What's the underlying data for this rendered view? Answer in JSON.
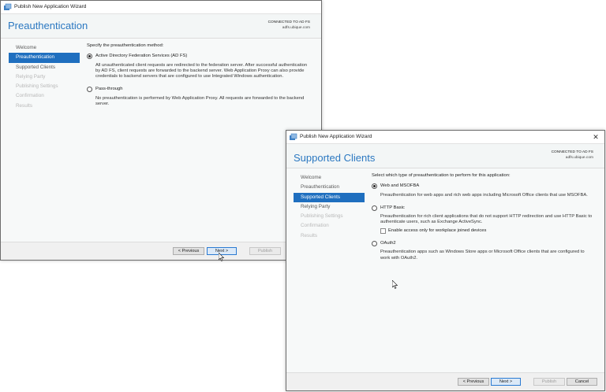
{
  "window1": {
    "title": "Publish New Application Wizard",
    "close_glyph": "✕",
    "icon": "wizard-app-icon",
    "page_title": "Preauthentication",
    "connection_label": "CONNECTED TO AD FS",
    "connection_server": "adfs.ubique.com",
    "nav": [
      {
        "label": "Welcome",
        "state": "normal"
      },
      {
        "label": "Preauthentication",
        "state": "active"
      },
      {
        "label": "Supported Clients",
        "state": "normal"
      },
      {
        "label": "Relying Party",
        "state": "disabled"
      },
      {
        "label": "Publishing Settings",
        "state": "disabled"
      },
      {
        "label": "Confirmation",
        "state": "disabled"
      },
      {
        "label": "Results",
        "state": "disabled"
      }
    ],
    "prompt": "Specify the preauthentication method:",
    "options": [
      {
        "label": "Active Directory Federation Services (AD FS)",
        "selected": true,
        "description": "All unauthenticated client requests are redirected to the federation server. After successful authentication by AD FS, client requests are forwarded to the backend server. Web Application Proxy can also provide credentials to backend servers that are configured to use Integrated Windows authentication."
      },
      {
        "label": "Pass-through",
        "selected": false,
        "description": "No preauthentication is performed by Web Application Proxy. All requests are forwarded to the backend server."
      }
    ],
    "buttons": {
      "previous": "< Previous",
      "next": "Next >",
      "publish": "Publish"
    }
  },
  "window2": {
    "title": "Publish New Application Wizard",
    "close_glyph": "✕",
    "icon": "wizard-app-icon",
    "page_title": "Supported Clients",
    "connection_label": "CONNECTED TO AD FS",
    "connection_server": "adfs.ubique.com",
    "nav": [
      {
        "label": "Welcome",
        "state": "normal"
      },
      {
        "label": "Preauthentication",
        "state": "normal"
      },
      {
        "label": "Supported Clients",
        "state": "active"
      },
      {
        "label": "Relying Party",
        "state": "normal"
      },
      {
        "label": "Publishing Settings",
        "state": "disabled"
      },
      {
        "label": "Confirmation",
        "state": "disabled"
      },
      {
        "label": "Results",
        "state": "disabled"
      }
    ],
    "prompt": "Select which type of preauthentication to perform for this application:",
    "options": [
      {
        "label": "Web and MSOFBA",
        "selected": true,
        "description": "Preauthentication for web apps and rich web apps including Microsoft Office clients that use MSOFBA."
      },
      {
        "label": "HTTP Basic",
        "selected": false,
        "description": "Preauthentication for rich client applications that do not support HTTP redirection and use HTTP Basic to authenticate users, such as Exchange ActiveSync."
      },
      {
        "label": "OAuth2",
        "selected": false,
        "description": "Preauthentication apps such as Windows Store apps or Microsoft Office clients that are configured to work with OAuth2."
      }
    ],
    "checkbox_label": "Enable access only for workplace joined devices",
    "checkbox_checked": false,
    "buttons": {
      "previous": "< Previous",
      "next": "Next >",
      "publish": "Publish",
      "cancel": "Cancel"
    }
  },
  "colors": {
    "accent": "#2b78c1",
    "active_nav": "#1f6fbf",
    "primary_button_border": "#2a7ad2"
  }
}
